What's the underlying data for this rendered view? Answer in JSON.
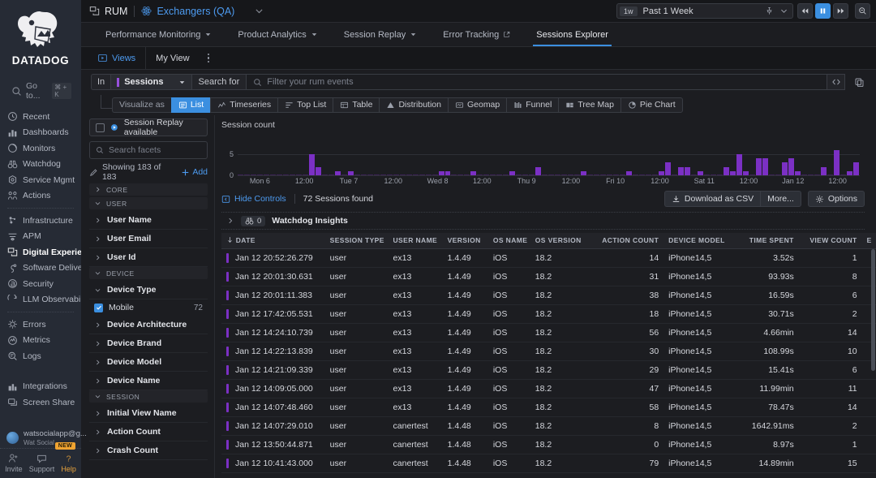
{
  "brand": {
    "name": "DATADOG",
    "accent": "#3b8fe0",
    "purple": "#7b30c4"
  },
  "sidebar": {
    "goto_label": "Go to...",
    "goto_kbd": "⌘ + K",
    "items": [
      {
        "label": "Recent",
        "icon": "clock-icon",
        "active": false
      },
      {
        "label": "Dashboards",
        "icon": "dashboard-icon",
        "active": false
      },
      {
        "label": "Monitors",
        "icon": "monitor-icon",
        "active": false
      },
      {
        "label": "Watchdog",
        "icon": "binoculars-icon",
        "active": false
      },
      {
        "label": "Service Mgmt",
        "icon": "service-icon",
        "active": false
      },
      {
        "label": "Actions",
        "icon": "actions-icon",
        "active": false
      },
      {
        "label": "Infrastructure",
        "icon": "infrastructure-icon",
        "active": false
      },
      {
        "label": "APM",
        "icon": "apm-icon",
        "active": false
      },
      {
        "label": "Digital Experience",
        "icon": "digital-experience-icon",
        "active": true
      },
      {
        "label": "Software Delivery",
        "icon": "software-delivery-icon",
        "active": false
      },
      {
        "label": "Security",
        "icon": "security-icon",
        "active": false
      },
      {
        "label": "LLM Observability",
        "icon": "llm-icon",
        "active": false
      },
      {
        "label": "Errors",
        "icon": "errors-icon",
        "active": false
      },
      {
        "label": "Metrics",
        "icon": "metrics-icon",
        "active": false
      },
      {
        "label": "Logs",
        "icon": "logs-icon",
        "active": false
      },
      {
        "label": "Integrations",
        "icon": "integrations-icon",
        "active": false
      },
      {
        "label": "Screen Share",
        "icon": "screen-share-icon",
        "active": false
      }
    ],
    "account": {
      "email": "watsocialapp@g...",
      "org": "Wat Social"
    },
    "footer": [
      {
        "label": "Invite",
        "icon": "invite-icon"
      },
      {
        "label": "Support",
        "icon": "support-icon"
      },
      {
        "label": "Help",
        "icon": "help-icon"
      }
    ],
    "new_badge": "NEW"
  },
  "topbar": {
    "product": "RUM",
    "scope": "Exchangers (QA)",
    "time": {
      "chip": "1w",
      "label": "Past 1 Week"
    },
    "playback": [
      {
        "name": "rewind",
        "active": false
      },
      {
        "name": "pause",
        "active": true
      },
      {
        "name": "forward",
        "active": false
      },
      {
        "name": "zoom-out",
        "active": false
      }
    ]
  },
  "nav_tabs": [
    {
      "label": "Performance Monitoring",
      "caret": true,
      "external": false,
      "selected": false
    },
    {
      "label": "Product Analytics",
      "caret": true,
      "external": false,
      "selected": false
    },
    {
      "label": "Session Replay",
      "caret": true,
      "external": false,
      "selected": false
    },
    {
      "label": "Error Tracking",
      "caret": false,
      "external": true,
      "selected": false
    },
    {
      "label": "Sessions Explorer",
      "caret": false,
      "external": false,
      "selected": true
    }
  ],
  "view_bar": {
    "views_label": "Views",
    "my_view_label": "My View"
  },
  "query": {
    "in_label": "In",
    "source_label": "Sessions",
    "search_for_label": "Search for",
    "placeholder": "Filter your rum events"
  },
  "visualize": {
    "label": "Visualize as",
    "options": [
      {
        "label": "List",
        "icon": "list-icon",
        "selected": true
      },
      {
        "label": "Timeseries",
        "icon": "timeseries-icon",
        "selected": false
      },
      {
        "label": "Top List",
        "icon": "toplist-icon",
        "selected": false
      },
      {
        "label": "Table",
        "icon": "table-icon",
        "selected": false
      },
      {
        "label": "Distribution",
        "icon": "distribution-icon",
        "selected": false
      },
      {
        "label": "Geomap",
        "icon": "geomap-icon",
        "selected": false
      },
      {
        "label": "Funnel",
        "icon": "funnel-icon",
        "selected": false
      },
      {
        "label": "Tree Map",
        "icon": "treemap-icon",
        "selected": false
      },
      {
        "label": "Pie Chart",
        "icon": "piechart-icon",
        "selected": false
      }
    ]
  },
  "facets": {
    "replay_label": "Session Replay available",
    "search_placeholder": "Search facets",
    "showing": "Showing 183 of 183",
    "add_label": "Add",
    "groups": [
      {
        "type": "group",
        "label": "CORE",
        "expanded": false
      },
      {
        "type": "group",
        "label": "USER",
        "expanded": true
      },
      {
        "type": "facet",
        "label": "User Name"
      },
      {
        "type": "facet",
        "label": "User Email"
      },
      {
        "type": "facet",
        "label": "User Id"
      },
      {
        "type": "group",
        "label": "DEVICE",
        "expanded": true
      },
      {
        "type": "facet",
        "label": "Device Type",
        "expanded": true
      },
      {
        "type": "value",
        "label": "Mobile",
        "count": "72",
        "checked": true
      },
      {
        "type": "facet",
        "label": "Device Architecture"
      },
      {
        "type": "facet",
        "label": "Device Brand"
      },
      {
        "type": "facet",
        "label": "Device Model"
      },
      {
        "type": "facet",
        "label": "Device Name"
      },
      {
        "type": "group",
        "label": "SESSION",
        "expanded": true
      },
      {
        "type": "facet",
        "label": "Initial View Name"
      },
      {
        "type": "facet",
        "label": "Action Count"
      },
      {
        "type": "facet",
        "label": "Crash Count"
      }
    ]
  },
  "chart_data": {
    "type": "bar",
    "title": "Session count",
    "xlabel": "",
    "ylabel": "",
    "ylim": [
      0,
      10
    ],
    "yticks": [
      0,
      5
    ],
    "grid": true,
    "legend": null,
    "color": "#7b30c4",
    "xticklabels": [
      "Mon 6",
      "12:00",
      "Tue 7",
      "12:00",
      "Wed 8",
      "12:00",
      "Thu 9",
      "12:00",
      "Fri 10",
      "12:00",
      "Sat 11",
      "12:00",
      "Jan 12",
      "12:00"
    ],
    "values": [
      0,
      0,
      0,
      0,
      0,
      0,
      0,
      0,
      0,
      0,
      0,
      5,
      2,
      0,
      0,
      1,
      0,
      1,
      0,
      0,
      0,
      0,
      0,
      0,
      0,
      0,
      0,
      0,
      0,
      0,
      0,
      1,
      1,
      0,
      0,
      0,
      1,
      0,
      0,
      0,
      0,
      0,
      1,
      0,
      0,
      0,
      2,
      0,
      0,
      0,
      0,
      0,
      0,
      1,
      0,
      0,
      0,
      0,
      0,
      0,
      1,
      0,
      0,
      0,
      0,
      1,
      3,
      0,
      2,
      2,
      0,
      1,
      0,
      0,
      0,
      2,
      1,
      5,
      1,
      0,
      4,
      4,
      0,
      0,
      3,
      4,
      1,
      0,
      0,
      0,
      2,
      0,
      6,
      0,
      1,
      3
    ]
  },
  "controls": {
    "hide_controls": "Hide Controls",
    "sessions_found": "72 Sessions found",
    "download_csv": "Download as CSV",
    "more": "More...",
    "options": "Options"
  },
  "watchdog": {
    "count": "0",
    "label": "Watchdog Insights"
  },
  "table": {
    "columns": [
      {
        "key": "date",
        "label": "DATE",
        "align": "left",
        "sorted": true
      },
      {
        "key": "session_type",
        "label": "SESSION TYPE",
        "align": "left"
      },
      {
        "key": "user_name",
        "label": "USER NAME",
        "align": "left"
      },
      {
        "key": "version",
        "label": "VERSION",
        "align": "left"
      },
      {
        "key": "os_name",
        "label": "OS NAME",
        "align": "left"
      },
      {
        "key": "os_version",
        "label": "OS VERSION",
        "align": "left"
      },
      {
        "key": "action_count",
        "label": "ACTION COUNT",
        "align": "right"
      },
      {
        "key": "device_model",
        "label": "DEVICE MODEL",
        "align": "left"
      },
      {
        "key": "time_spent",
        "label": "TIME SPENT",
        "align": "right"
      },
      {
        "key": "view_count",
        "label": "VIEW COUNT",
        "align": "right"
      },
      {
        "key": "e",
        "label": "E",
        "align": "left"
      }
    ],
    "rows": [
      {
        "date": "Jan 12 20:52:26.279",
        "session_type": "user",
        "user_name": "ex13",
        "version": "1.4.49",
        "os_name": "iOS",
        "os_version": "18.2",
        "action_count": "14",
        "device_model": "iPhone14,5",
        "time_spent": "3.52s",
        "view_count": "1",
        "e": ""
      },
      {
        "date": "Jan 12 20:01:30.631",
        "session_type": "user",
        "user_name": "ex13",
        "version": "1.4.49",
        "os_name": "iOS",
        "os_version": "18.2",
        "action_count": "31",
        "device_model": "iPhone14,5",
        "time_spent": "93.93s",
        "view_count": "8",
        "e": ""
      },
      {
        "date": "Jan 12 20:01:11.383",
        "session_type": "user",
        "user_name": "ex13",
        "version": "1.4.49",
        "os_name": "iOS",
        "os_version": "18.2",
        "action_count": "38",
        "device_model": "iPhone14,5",
        "time_spent": "16.59s",
        "view_count": "6",
        "e": ""
      },
      {
        "date": "Jan 12 17:42:05.531",
        "session_type": "user",
        "user_name": "ex13",
        "version": "1.4.49",
        "os_name": "iOS",
        "os_version": "18.2",
        "action_count": "18",
        "device_model": "iPhone14,5",
        "time_spent": "30.71s",
        "view_count": "2",
        "e": ""
      },
      {
        "date": "Jan 12 14:24:10.739",
        "session_type": "user",
        "user_name": "ex13",
        "version": "1.4.49",
        "os_name": "iOS",
        "os_version": "18.2",
        "action_count": "56",
        "device_model": "iPhone14,5",
        "time_spent": "4.66min",
        "view_count": "14",
        "e": ""
      },
      {
        "date": "Jan 12 14:22:13.839",
        "session_type": "user",
        "user_name": "ex13",
        "version": "1.4.49",
        "os_name": "iOS",
        "os_version": "18.2",
        "action_count": "30",
        "device_model": "iPhone14,5",
        "time_spent": "108.99s",
        "view_count": "10",
        "e": ""
      },
      {
        "date": "Jan 12 14:21:09.339",
        "session_type": "user",
        "user_name": "ex13",
        "version": "1.4.49",
        "os_name": "iOS",
        "os_version": "18.2",
        "action_count": "29",
        "device_model": "iPhone14,5",
        "time_spent": "15.41s",
        "view_count": "6",
        "e": ""
      },
      {
        "date": "Jan 12 14:09:05.000",
        "session_type": "user",
        "user_name": "ex13",
        "version": "1.4.49",
        "os_name": "iOS",
        "os_version": "18.2",
        "action_count": "47",
        "device_model": "iPhone14,5",
        "time_spent": "11.99min",
        "view_count": "11",
        "e": ""
      },
      {
        "date": "Jan 12 14:07:48.460",
        "session_type": "user",
        "user_name": "ex13",
        "version": "1.4.49",
        "os_name": "iOS",
        "os_version": "18.2",
        "action_count": "58",
        "device_model": "iPhone14,5",
        "time_spent": "78.47s",
        "view_count": "14",
        "e": ""
      },
      {
        "date": "Jan 12 14:07:29.010",
        "session_type": "user",
        "user_name": "canertest",
        "version": "1.4.48",
        "os_name": "iOS",
        "os_version": "18.2",
        "action_count": "8",
        "device_model": "iPhone14,5",
        "time_spent": "1642.91ms",
        "view_count": "2",
        "e": ""
      },
      {
        "date": "Jan 12 13:50:44.871",
        "session_type": "user",
        "user_name": "canertest",
        "version": "1.4.48",
        "os_name": "iOS",
        "os_version": "18.2",
        "action_count": "0",
        "device_model": "iPhone14,5",
        "time_spent": "8.97s",
        "view_count": "1",
        "e": ""
      },
      {
        "date": "Jan 12 10:41:43.000",
        "session_type": "user",
        "user_name": "canertest",
        "version": "1.4.48",
        "os_name": "iOS",
        "os_version": "18.2",
        "action_count": "79",
        "device_model": "iPhone14,5",
        "time_spent": "14.89min",
        "view_count": "15",
        "e": ""
      }
    ]
  }
}
